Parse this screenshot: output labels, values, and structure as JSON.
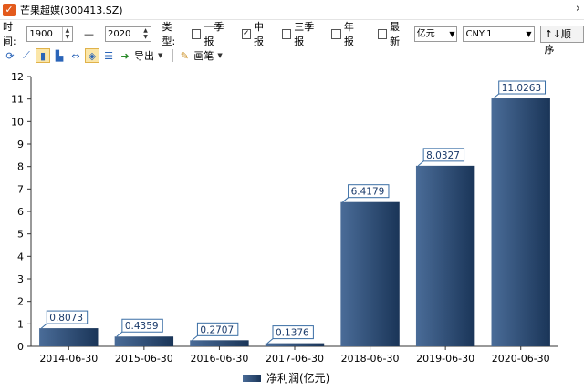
{
  "window": {
    "title": "芒果超媒(300413.SZ)",
    "app_icon": "check-icon",
    "close_icon": "chevron-right-icon"
  },
  "options": {
    "time_label": "时间:",
    "year_from": "1900",
    "dash": "—",
    "year_to": "2020",
    "type_label": "类型:",
    "report_types": [
      {
        "label": "一季报",
        "checked": false
      },
      {
        "label": "中报",
        "checked": true
      },
      {
        "label": "三季报",
        "checked": false
      },
      {
        "label": "年报",
        "checked": false
      }
    ],
    "latest": {
      "label": "最新",
      "checked": false
    },
    "unit": "亿元",
    "currency": "CNY:1",
    "sort_label": "顺序"
  },
  "toolbar": {
    "export_label": "导出",
    "draw_label": "画笔"
  },
  "chart_data": {
    "type": "bar",
    "categories": [
      "2014-06-30",
      "2015-06-30",
      "2016-06-30",
      "2017-06-30",
      "2018-06-30",
      "2019-06-30",
      "2020-06-30"
    ],
    "series": [
      {
        "name": "净利润(亿元)",
        "values": [
          0.8073,
          0.4359,
          0.2707,
          0.1376,
          6.4179,
          8.0327,
          11.0263
        ]
      }
    ],
    "data_labels": [
      "0.8073",
      "0.4359",
      "0.2707",
      "0.1376",
      "6.4179",
      "8.0327",
      "11.0263"
    ],
    "yticks": [
      "0",
      "1",
      "2",
      "3",
      "4",
      "5",
      "6",
      "7",
      "8",
      "9",
      "10",
      "11",
      "12"
    ],
    "ylim": [
      0,
      12
    ],
    "grid": false,
    "legend": "bottom-center",
    "colors": {
      "bar_light": "#4a6c98",
      "bar_dark": "#1a3558",
      "label_border": "#3a6ea5"
    }
  }
}
